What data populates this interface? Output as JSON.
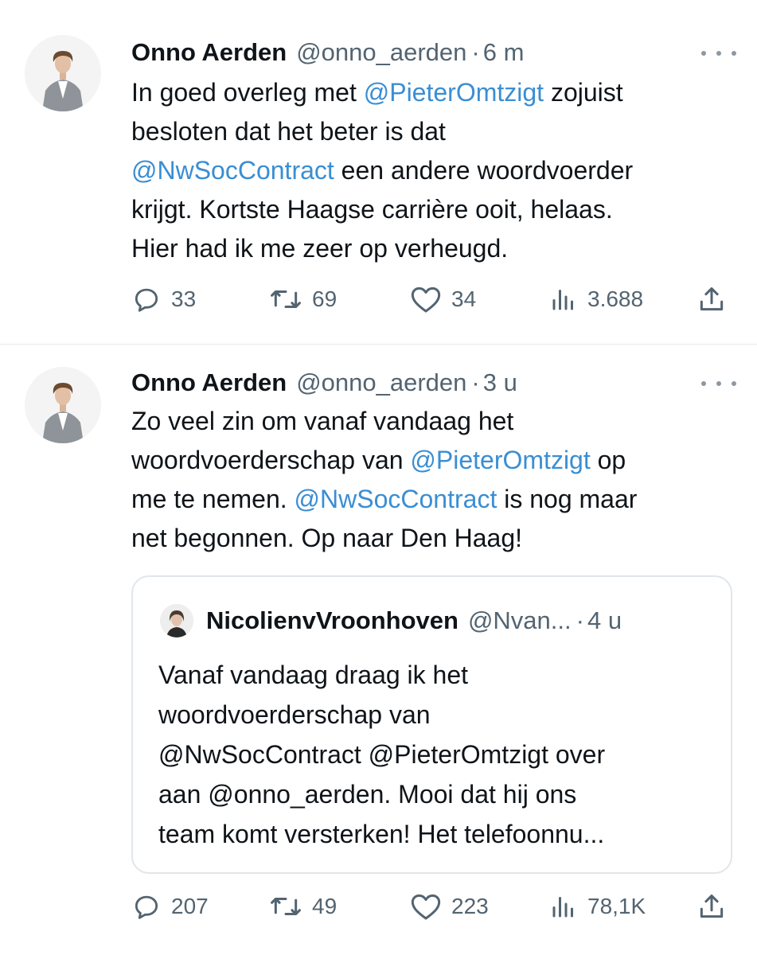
{
  "tweets": [
    {
      "author_name": "Onno Aerden",
      "handle": "@onno_aerden",
      "separator": "·",
      "time": "6 m",
      "lines": [
        [
          {
            "t": "In goed overleg met "
          },
          {
            "t": "@PieterOmtzigt",
            "m": true
          },
          {
            "t": " zojuist"
          }
        ],
        [
          {
            "t": "besloten dat het beter is dat"
          }
        ],
        [
          {
            "t": "@NwSocContract",
            "m": true
          },
          {
            "t": " een andere woordvoerder"
          }
        ],
        [
          {
            "t": "krijgt. Kortste Haagse carrière ooit, helaas."
          }
        ],
        [
          {
            "t": "Hier had ik me zeer op verheugd."
          }
        ]
      ],
      "stats": {
        "replies": "33",
        "reposts": "69",
        "likes": "34",
        "views": "3.688"
      }
    },
    {
      "author_name": "Onno Aerden",
      "handle": "@onno_aerden",
      "separator": "·",
      "time": "3 u",
      "lines": [
        [
          {
            "t": "Zo veel zin om vanaf vandaag het"
          }
        ],
        [
          {
            "t": "woordvoerderschap van "
          },
          {
            "t": "@PieterOmtzigt",
            "m": true
          },
          {
            "t": " op"
          }
        ],
        [
          {
            "t": "me te nemen. "
          },
          {
            "t": "@NwSocContract",
            "m": true
          },
          {
            "t": " is nog maar"
          }
        ],
        [
          {
            "t": "net begonnen. Op naar Den Haag!"
          }
        ]
      ],
      "quote": {
        "author_name": "NicolienvVroonhoven",
        "handle": "@Nvan...",
        "separator": "·",
        "time": "4 u",
        "lines": [
          "Vanaf vandaag draag ik het",
          "woordvoerderschap van",
          "@NwSocContract @PieterOmtzigt over",
          "aan @onno_aerden. Mooi dat hij ons",
          "team komt versterken! Het telefoonnu..."
        ]
      },
      "stats": {
        "replies": "207",
        "reposts": "49",
        "likes": "223",
        "views": "78,1K"
      }
    }
  ],
  "icons": [
    "more-icon",
    "reply-icon",
    "retweet-icon",
    "like-icon",
    "views-icon",
    "share-icon"
  ],
  "colors": {
    "text": "#0f1419",
    "secondary": "#536471",
    "mention": "#3a8ed3",
    "border": "#e1e6ea"
  }
}
